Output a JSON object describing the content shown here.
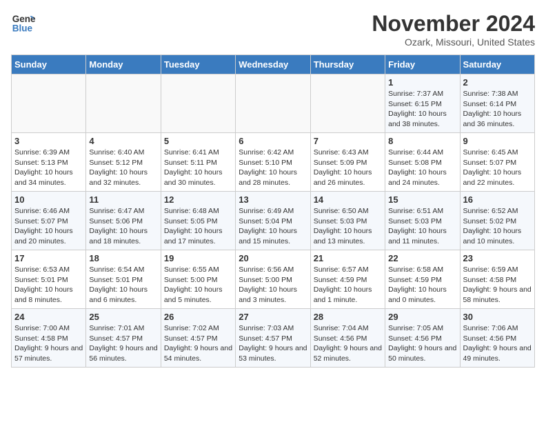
{
  "logo": {
    "line1": "General",
    "line2": "Blue"
  },
  "title": "November 2024",
  "location": "Ozark, Missouri, United States",
  "days_of_week": [
    "Sunday",
    "Monday",
    "Tuesday",
    "Wednesday",
    "Thursday",
    "Friday",
    "Saturday"
  ],
  "weeks": [
    [
      {
        "day": "",
        "info": ""
      },
      {
        "day": "",
        "info": ""
      },
      {
        "day": "",
        "info": ""
      },
      {
        "day": "",
        "info": ""
      },
      {
        "day": "",
        "info": ""
      },
      {
        "day": "1",
        "info": "Sunrise: 7:37 AM\nSunset: 6:15 PM\nDaylight: 10 hours and 38 minutes."
      },
      {
        "day": "2",
        "info": "Sunrise: 7:38 AM\nSunset: 6:14 PM\nDaylight: 10 hours and 36 minutes."
      }
    ],
    [
      {
        "day": "3",
        "info": "Sunrise: 6:39 AM\nSunset: 5:13 PM\nDaylight: 10 hours and 34 minutes."
      },
      {
        "day": "4",
        "info": "Sunrise: 6:40 AM\nSunset: 5:12 PM\nDaylight: 10 hours and 32 minutes."
      },
      {
        "day": "5",
        "info": "Sunrise: 6:41 AM\nSunset: 5:11 PM\nDaylight: 10 hours and 30 minutes."
      },
      {
        "day": "6",
        "info": "Sunrise: 6:42 AM\nSunset: 5:10 PM\nDaylight: 10 hours and 28 minutes."
      },
      {
        "day": "7",
        "info": "Sunrise: 6:43 AM\nSunset: 5:09 PM\nDaylight: 10 hours and 26 minutes."
      },
      {
        "day": "8",
        "info": "Sunrise: 6:44 AM\nSunset: 5:08 PM\nDaylight: 10 hours and 24 minutes."
      },
      {
        "day": "9",
        "info": "Sunrise: 6:45 AM\nSunset: 5:07 PM\nDaylight: 10 hours and 22 minutes."
      }
    ],
    [
      {
        "day": "10",
        "info": "Sunrise: 6:46 AM\nSunset: 5:07 PM\nDaylight: 10 hours and 20 minutes."
      },
      {
        "day": "11",
        "info": "Sunrise: 6:47 AM\nSunset: 5:06 PM\nDaylight: 10 hours and 18 minutes."
      },
      {
        "day": "12",
        "info": "Sunrise: 6:48 AM\nSunset: 5:05 PM\nDaylight: 10 hours and 17 minutes."
      },
      {
        "day": "13",
        "info": "Sunrise: 6:49 AM\nSunset: 5:04 PM\nDaylight: 10 hours and 15 minutes."
      },
      {
        "day": "14",
        "info": "Sunrise: 6:50 AM\nSunset: 5:03 PM\nDaylight: 10 hours and 13 minutes."
      },
      {
        "day": "15",
        "info": "Sunrise: 6:51 AM\nSunset: 5:03 PM\nDaylight: 10 hours and 11 minutes."
      },
      {
        "day": "16",
        "info": "Sunrise: 6:52 AM\nSunset: 5:02 PM\nDaylight: 10 hours and 10 minutes."
      }
    ],
    [
      {
        "day": "17",
        "info": "Sunrise: 6:53 AM\nSunset: 5:01 PM\nDaylight: 10 hours and 8 minutes."
      },
      {
        "day": "18",
        "info": "Sunrise: 6:54 AM\nSunset: 5:01 PM\nDaylight: 10 hours and 6 minutes."
      },
      {
        "day": "19",
        "info": "Sunrise: 6:55 AM\nSunset: 5:00 PM\nDaylight: 10 hours and 5 minutes."
      },
      {
        "day": "20",
        "info": "Sunrise: 6:56 AM\nSunset: 5:00 PM\nDaylight: 10 hours and 3 minutes."
      },
      {
        "day": "21",
        "info": "Sunrise: 6:57 AM\nSunset: 4:59 PM\nDaylight: 10 hours and 1 minute."
      },
      {
        "day": "22",
        "info": "Sunrise: 6:58 AM\nSunset: 4:59 PM\nDaylight: 10 hours and 0 minutes."
      },
      {
        "day": "23",
        "info": "Sunrise: 6:59 AM\nSunset: 4:58 PM\nDaylight: 9 hours and 58 minutes."
      }
    ],
    [
      {
        "day": "24",
        "info": "Sunrise: 7:00 AM\nSunset: 4:58 PM\nDaylight: 9 hours and 57 minutes."
      },
      {
        "day": "25",
        "info": "Sunrise: 7:01 AM\nSunset: 4:57 PM\nDaylight: 9 hours and 56 minutes."
      },
      {
        "day": "26",
        "info": "Sunrise: 7:02 AM\nSunset: 4:57 PM\nDaylight: 9 hours and 54 minutes."
      },
      {
        "day": "27",
        "info": "Sunrise: 7:03 AM\nSunset: 4:57 PM\nDaylight: 9 hours and 53 minutes."
      },
      {
        "day": "28",
        "info": "Sunrise: 7:04 AM\nSunset: 4:56 PM\nDaylight: 9 hours and 52 minutes."
      },
      {
        "day": "29",
        "info": "Sunrise: 7:05 AM\nSunset: 4:56 PM\nDaylight: 9 hours and 50 minutes."
      },
      {
        "day": "30",
        "info": "Sunrise: 7:06 AM\nSunset: 4:56 PM\nDaylight: 9 hours and 49 minutes."
      }
    ]
  ]
}
